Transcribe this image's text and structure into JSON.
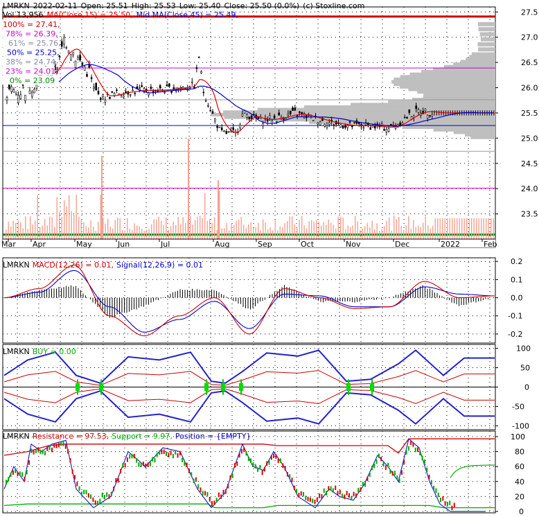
{
  "header": {
    "symbol": "LMRKN",
    "date": "2022-02-11",
    "open": "Open: 25.51",
    "high": "High: 25.53",
    "low": "Low: 25.40",
    "close": "Close: 25.50 (0.0%)",
    "source": "(c) Stoxline.com"
  },
  "legend": {
    "vol": "Vol 13,956",
    "ma": "MA(Close,15) = 25.50,",
    "mid_ma": "Mid MA(Close,45) = 25.49,"
  },
  "fib": [
    {
      "label": "100% = 27.41,",
      "color": "#cc0000"
    },
    {
      "label": "78% = 26.39,",
      "color": "#cc00cc"
    },
    {
      "label": "61% = 25.76,",
      "color": "#8888aa"
    },
    {
      "label": "50% = 25.25,",
      "color": "#0000cc"
    },
    {
      "label": "38% = 24.74,",
      "color": "#8888aa"
    },
    {
      "label": "23% = 24.01,",
      "color": "#cc00cc"
    },
    {
      "label": "0% = 23.09",
      "color": "#008800"
    }
  ],
  "colors": {
    "ma15": "#dd0000",
    "ma45": "#0000cc",
    "volume": "#f4a090",
    "up": "#00aa00",
    "down": "#dd0000",
    "profile": "#bfbfbf"
  },
  "chart_data": [
    {
      "type": "candlestick",
      "title": "LMRKN 2022-02-11",
      "x_tick_labels": [
        "Mar",
        "Apr",
        "May",
        "Jun",
        "Jul",
        "Aug",
        "Sep",
        "Oct",
        "Nov",
        "Dec",
        "2022",
        "Feb"
      ],
      "y_tick_labels": [
        "27.5",
        "27.0",
        "26.5",
        "26.0",
        "25.5",
        "25.0",
        "24.5",
        "24.0",
        "23.5"
      ],
      "ylim": [
        23.0,
        27.6
      ],
      "horizontal_levels": [
        27.41,
        26.39,
        25.76,
        25.25,
        24.74,
        24.01,
        23.09
      ],
      "close_path": [
        {
          "x": "Mar",
          "y": 25.9
        },
        {
          "x": "Apr",
          "y": 26.5
        },
        {
          "x": "May",
          "y": 26.8
        },
        {
          "x": "May-mid",
          "y": 25.8
        },
        {
          "x": "Jun",
          "y": 25.95
        },
        {
          "x": "Jul",
          "y": 25.95
        },
        {
          "x": "Jul-late",
          "y": 26.0
        },
        {
          "x": "Aug",
          "y": 25.3
        },
        {
          "x": "Aug-late",
          "y": 25.1
        },
        {
          "x": "Sep",
          "y": 25.5
        },
        {
          "x": "Oct",
          "y": 25.4
        },
        {
          "x": "Nov",
          "y": 25.25
        },
        {
          "x": "Dec",
          "y": 25.25
        },
        {
          "x": "Dec-late",
          "y": 25.55
        },
        {
          "x": "2022",
          "y": 25.5
        },
        {
          "x": "Feb",
          "y": 25.5
        }
      ]
    },
    {
      "type": "line",
      "title": "MACD",
      "label": "MACD(12,26) = 0.01,",
      "signal_label": "Signal(12,26,9) = 0.01",
      "y_tick_labels": [
        "0.2",
        "0.1",
        "0.0",
        "-0.1",
        "-0.2"
      ],
      "ylim": [
        -0.25,
        0.22
      ],
      "series": [
        {
          "name": "MACD(12,26)",
          "values": [
            0.0,
            0.05,
            0.18,
            -0.1,
            -0.21,
            -0.1,
            0.0,
            -0.2,
            0.05,
            0.0,
            -0.06,
            -0.05,
            0.09,
            0.0,
            0.01
          ]
        },
        {
          "name": "Signal(12,26,9)",
          "values": [
            0.0,
            0.03,
            0.15,
            -0.05,
            -0.19,
            -0.12,
            -0.02,
            -0.17,
            0.02,
            0.01,
            -0.05,
            -0.05,
            0.06,
            0.02,
            0.01
          ]
        }
      ]
    },
    {
      "type": "line",
      "title": "BUY",
      "label": "BUY = 0.00",
      "y_tick_labels": [
        "100",
        "50",
        "0",
        "-50",
        "-100"
      ],
      "ylim": [
        -110,
        110
      ]
    },
    {
      "type": "line",
      "title": "Resistance / Support",
      "resistance_label": "Resistance = 97.53,",
      "support_label": "Support = 9.97,",
      "position_label": "Position = {EMPTY}",
      "y_tick_labels": [
        "100",
        "80",
        "60",
        "40",
        "20",
        "0"
      ],
      "ylim": [
        0,
        100
      ]
    }
  ]
}
